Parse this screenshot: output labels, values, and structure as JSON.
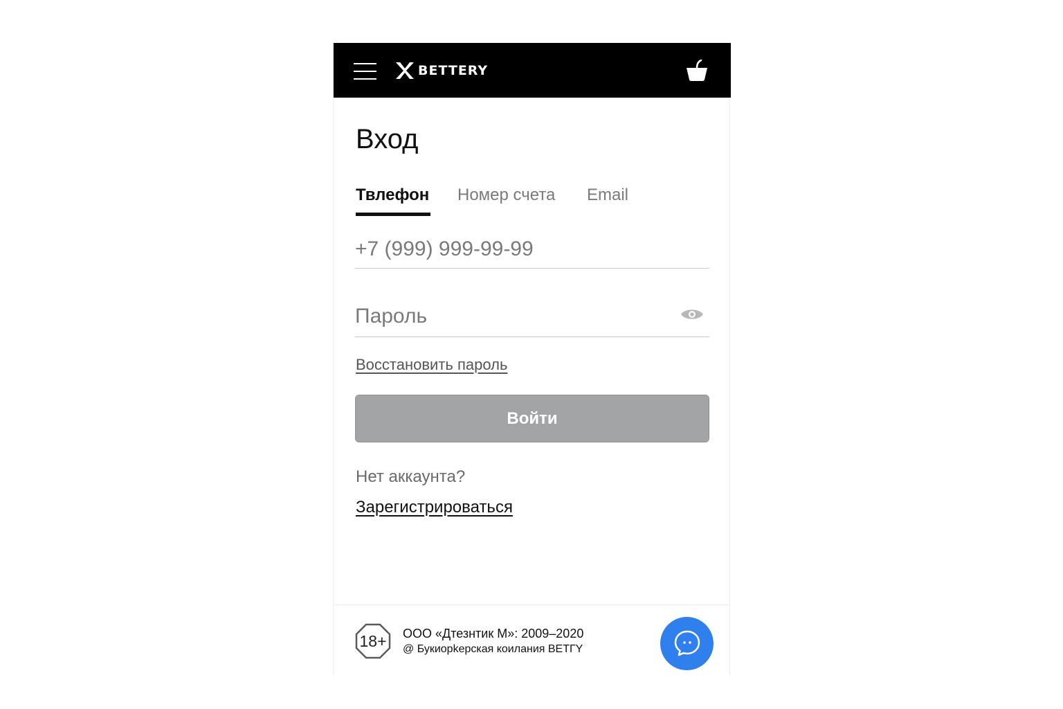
{
  "header": {
    "logo_text": "BETTERY",
    "menu_icon": "hamburger-menu-icon",
    "basket_icon": "basket-icon"
  },
  "page": {
    "title": "Вход"
  },
  "tabs": [
    {
      "label": "Твлефон",
      "active": true
    },
    {
      "label": "Номер счета",
      "active": false
    },
    {
      "label": "Email",
      "active": false
    }
  ],
  "form": {
    "phone_placeholder": "+7 (999) 999-99-99",
    "password_placeholder": "Пароль",
    "eye_icon": "eye-icon",
    "restore_label": "Восстановить пароль",
    "login_label": "Войти"
  },
  "register": {
    "question": "Нет аккаунта?",
    "link_label": "Зарегистрироваться"
  },
  "footer": {
    "age_label": "18+",
    "copyright_line1": "ООО «Дтезнтик М»: 2009–2020",
    "copyright_line2": "@ Букиорkерская коилания ВЕТГY",
    "chat_icon": "chat-icon"
  },
  "colors": {
    "header_bg": "#000000",
    "button_disabled": "#a3a4a6",
    "chat_blue": "#2f80ed"
  }
}
